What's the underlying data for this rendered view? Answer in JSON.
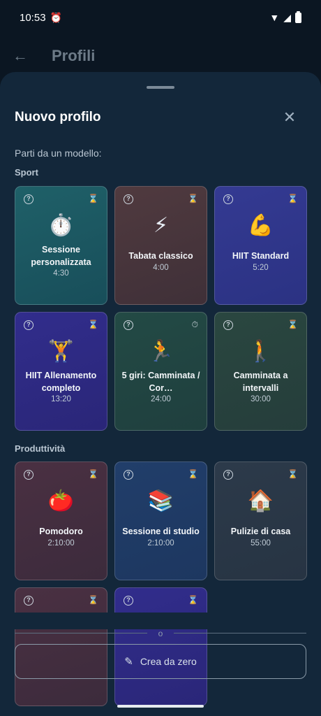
{
  "status": {
    "time": "10:53"
  },
  "appbar": {
    "title": "Profili"
  },
  "sheet": {
    "title": "Nuovo profilo",
    "subtitle": "Parti da un modello:",
    "sections": {
      "sport": "Sport",
      "produttivita": "Produttività"
    },
    "create_label": "Crea da zero",
    "divider_text": "o"
  },
  "cards": [
    {
      "name": "Sessione personalizzata",
      "duration": "4:30",
      "emoji": "⏱️",
      "corner_icon": "hourglass-icon"
    },
    {
      "name": "Tabata classico",
      "duration": "4:00",
      "emoji": "⚡",
      "corner_icon": "hourglass-icon"
    },
    {
      "name": "HIIT Standard",
      "duration": "5:20",
      "emoji": "💪",
      "corner_icon": "hourglass-icon"
    },
    {
      "name": "HIIT Allenamento completo",
      "duration": "13:20",
      "emoji": "🏋️",
      "corner_icon": "hourglass-icon"
    },
    {
      "name": "5 giri: Camminata / Cor…",
      "duration": "24:00",
      "emoji": "🏃",
      "corner_icon": "timer-icon"
    },
    {
      "name": "Camminata a intervalli",
      "duration": "30:00",
      "emoji": "🚶",
      "corner_icon": "hourglass-icon"
    },
    {
      "name": "Pomodoro",
      "duration": "2:10:00",
      "emoji": "🍅",
      "corner_icon": "hourglass-icon"
    },
    {
      "name": "Sessione di studio",
      "duration": "2:10:00",
      "emoji": "📚",
      "corner_icon": "hourglass-icon"
    },
    {
      "name": "Pulizie di casa",
      "duration": "55:00",
      "emoji": "🏠",
      "corner_icon": "hourglass-icon"
    }
  ]
}
